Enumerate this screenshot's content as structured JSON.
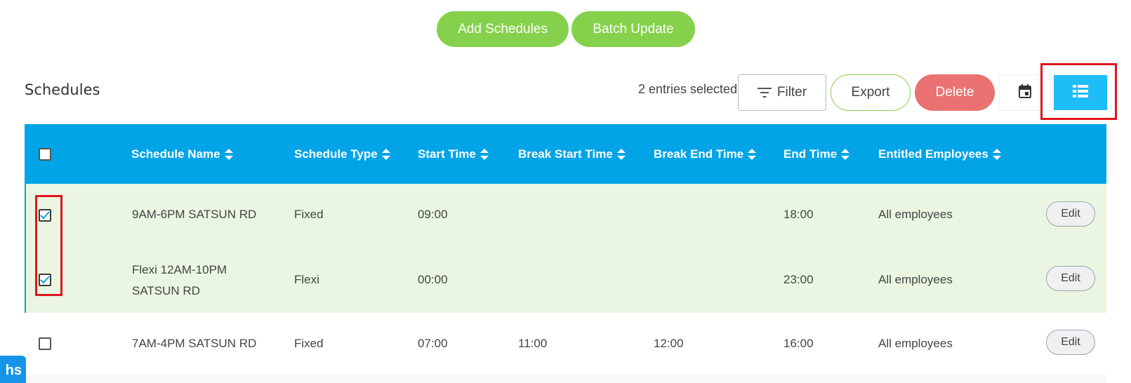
{
  "actions": {
    "add_schedules": "Add Schedules",
    "batch_update": "Batch Update"
  },
  "page": {
    "title": "Schedules"
  },
  "toolbar": {
    "selected_text": "2 entries selected",
    "filter": "Filter",
    "export": "Export",
    "delete": "Delete",
    "calendar_icon": "calendar-icon",
    "list_icon": "list-view-icon",
    "active_view": "list"
  },
  "table": {
    "columns": [
      "Schedule Name",
      "Schedule Type",
      "Start Time",
      "Break Start Time",
      "Break End Time",
      "End Time",
      "Entitled Employees"
    ],
    "rows": [
      {
        "selected": true,
        "name": "9AM-6PM SATSUN RD",
        "type": "Fixed",
        "start": "09:00",
        "break_start": "",
        "break_end": "",
        "end": "18:00",
        "entitled": "All employees",
        "action": "Edit"
      },
      {
        "selected": true,
        "name": "Flexi 12AM-10PM SATSUN RD",
        "type": "Flexi",
        "start": "00:00",
        "break_start": "",
        "break_end": "",
        "end": "23:00",
        "entitled": "All employees",
        "action": "Edit"
      },
      {
        "selected": false,
        "name": "7AM-4PM SATSUN RD",
        "type": "Fixed",
        "start": "07:00",
        "break_start": "11:00",
        "break_end": "12:00",
        "end": "16:00",
        "entitled": "All employees",
        "action": "Edit"
      }
    ]
  },
  "corner_tab": {
    "label": "hs"
  },
  "colors": {
    "accent_green": "#86d14b",
    "header_blue": "#00a4e7",
    "active_view_blue": "#1fbdf8",
    "delete_red": "#eb7272",
    "selected_row": "#eaf6e1",
    "highlight_red": "#e0161f"
  }
}
